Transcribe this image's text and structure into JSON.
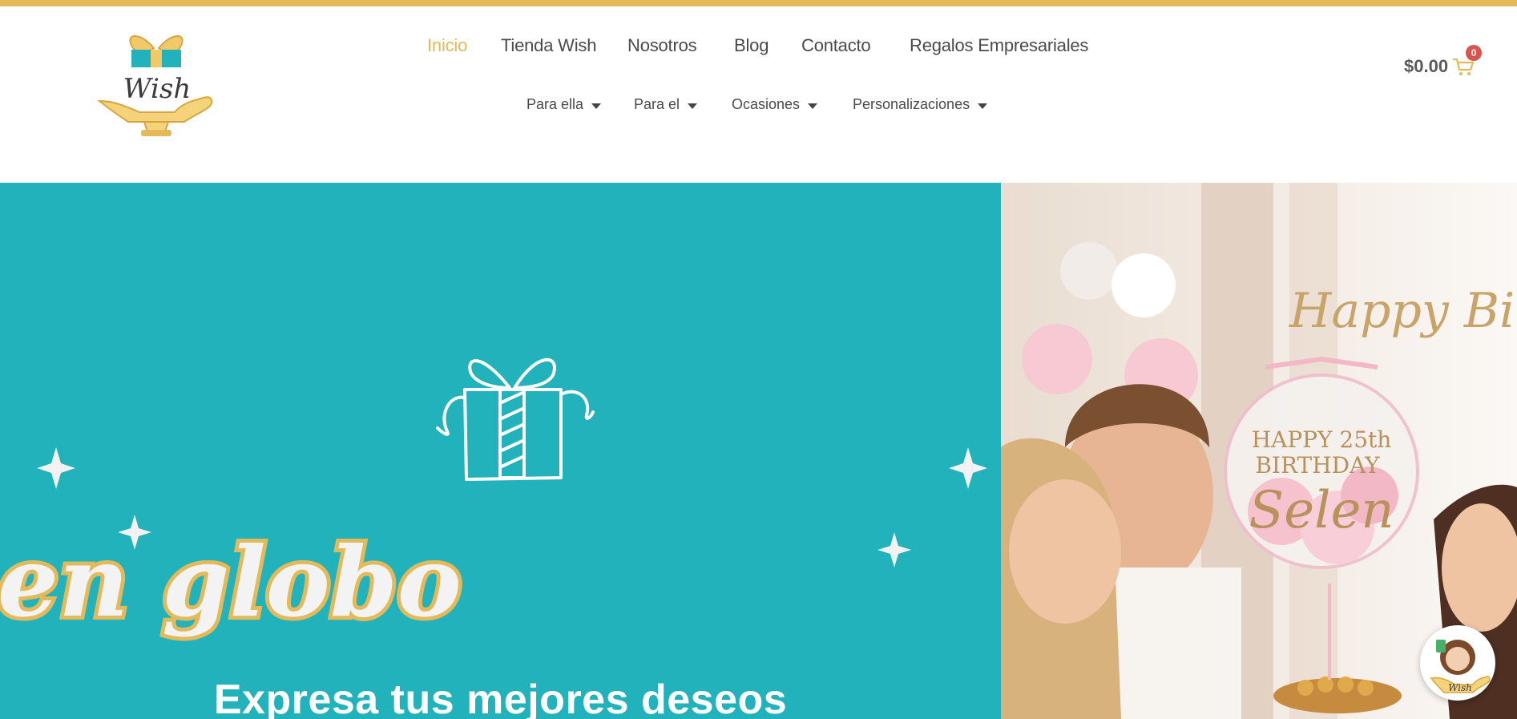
{
  "brand": {
    "logo_text": "Wish"
  },
  "main_nav": [
    {
      "label": "Inicio",
      "active": true
    },
    {
      "label": "Tienda Wish",
      "active": false
    },
    {
      "label": "Nosotros",
      "active": false
    },
    {
      "label": "Blog",
      "active": false
    },
    {
      "label": "Contacto",
      "active": false
    },
    {
      "label": "Regalos Empresariales",
      "active": false
    }
  ],
  "sub_nav": [
    {
      "label": "Para ella"
    },
    {
      "label": "Para el"
    },
    {
      "label": "Ocasiones"
    },
    {
      "label": "Personalizaciones"
    }
  ],
  "cart": {
    "amount": "$0.00",
    "count": "0",
    "icon": "shopping-cart-icon"
  },
  "hero": {
    "headline": "Regalos en globo",
    "subtitle": "Expresa tus mejores deseos",
    "photo": {
      "banner_text": "Happy Birthday",
      "balloon_line1": "HAPPY 25th",
      "balloon_line2": "BIRTHDAY",
      "balloon_name": "Selen"
    }
  },
  "chat_widget": {
    "logo_text": "Wish"
  },
  "colors": {
    "accent": "#e3b95a",
    "teal": "#22b2bb",
    "nav_text": "#4a4a4a",
    "badge": "#d9534f"
  }
}
